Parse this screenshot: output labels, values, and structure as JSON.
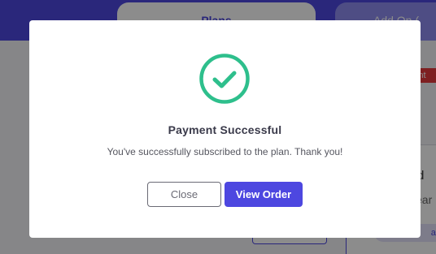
{
  "background": {
    "tabs": [
      {
        "label": "Plans"
      },
      {
        "label": "Add On ("
      }
    ],
    "badge_text": "nt",
    "panel_text_1": "d",
    "panel_text_2": "ear",
    "panel_chip": "an"
  },
  "modal": {
    "icon": "check-circle-icon",
    "title": "Payment Successful",
    "message": "You've successfully subscribed to the plan. Thank you!",
    "close_label": "Close",
    "view_order_label": "View Order"
  },
  "colors": {
    "primary": "#4d47e0",
    "success": "#2ebf8c",
    "overlay": "rgba(0,0,0,0.45)"
  }
}
